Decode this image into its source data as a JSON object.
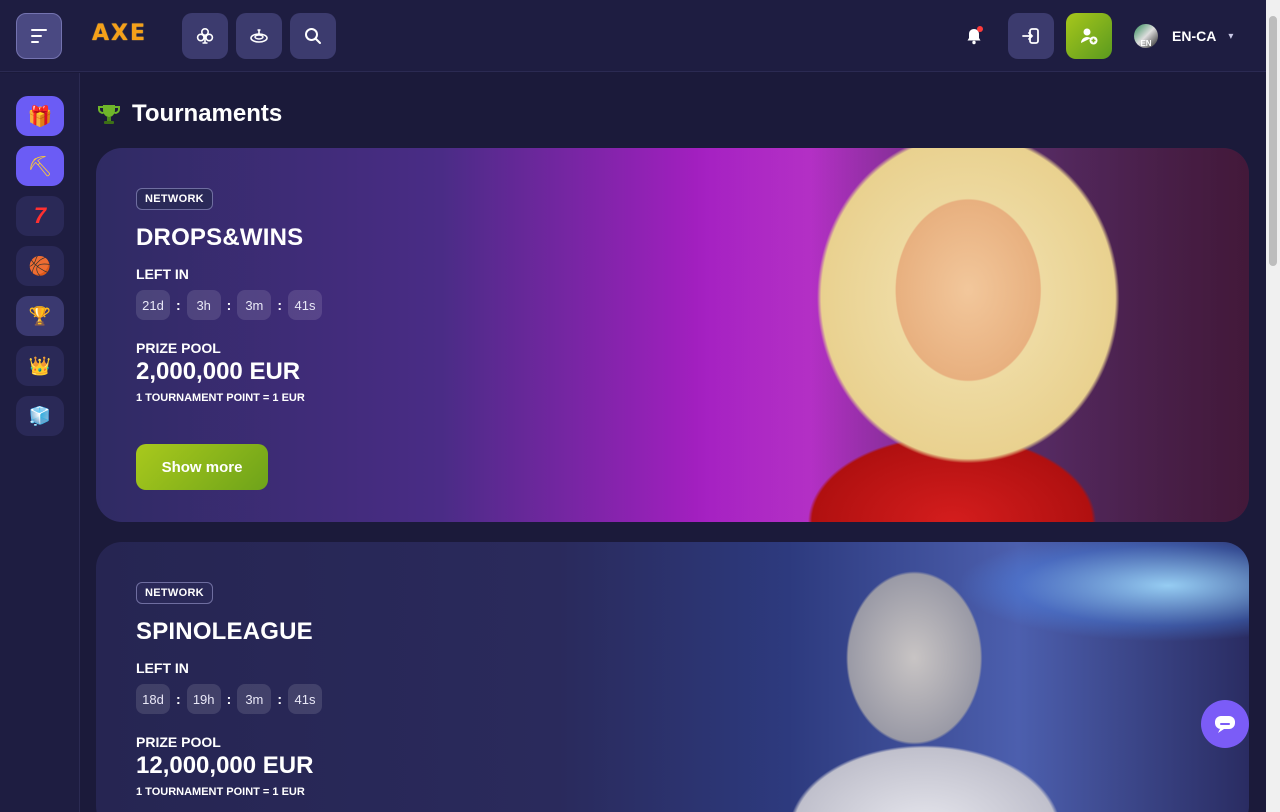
{
  "header": {
    "logo_text": "AXE",
    "lang": {
      "code": "EN-CA",
      "flag_text": "EN"
    }
  },
  "icons": {
    "menu": "menu-icon",
    "casino": "club-icon",
    "live": "roulette-icon",
    "search": "search-icon",
    "bell": "bell-icon",
    "login": "login-icon",
    "register": "add-user-icon",
    "chat": "chat-icon"
  },
  "sidebar": {
    "items": [
      {
        "name": "gift-box",
        "glyph": "🎁"
      },
      {
        "name": "pickaxe",
        "glyph": "⛏"
      },
      {
        "name": "slots-seven",
        "glyph": "7"
      },
      {
        "name": "ball",
        "glyph": "🏀"
      },
      {
        "name": "tournaments-trophy",
        "glyph": "🏆"
      },
      {
        "name": "crown",
        "glyph": "👑"
      },
      {
        "name": "cubes",
        "glyph": "🧊"
      }
    ]
  },
  "page": {
    "title": "Tournaments"
  },
  "tournaments": [
    {
      "badge": "NETWORK",
      "name": "DROPS&WINS",
      "left_in_label": "LEFT IN",
      "timer": [
        "21d",
        "3h",
        "3m",
        "41s"
      ],
      "prize_pool_label": "PRIZE POOL",
      "prize_pool_value": "2,000,000 EUR",
      "ratio": "1 TOURNAMENT POINT = 1 EUR",
      "button": "Show more"
    },
    {
      "badge": "NETWORK",
      "name": "SPINOLEAGUE",
      "left_in_label": "LEFT IN",
      "timer": [
        "18d",
        "19h",
        "3m",
        "41s"
      ],
      "prize_pool_label": "PRIZE POOL",
      "prize_pool_value": "12,000,000 EUR",
      "ratio": "1 TOURNAMENT POINT = 1 EUR"
    }
  ],
  "colors": {
    "background": "#1b1a3a",
    "accent_green": "#9bc21b",
    "accent_purple": "#6b5cf5",
    "chat": "#7b5cf7"
  }
}
